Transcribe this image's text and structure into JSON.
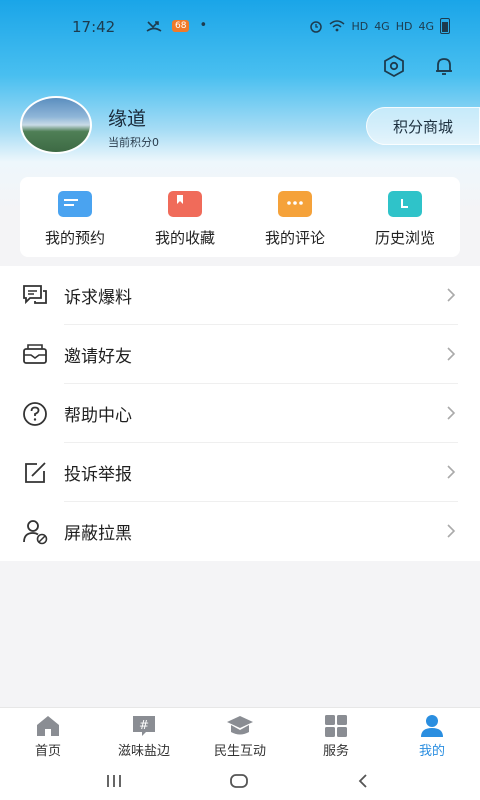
{
  "status_bar": {
    "time": "17:42",
    "network_labels": [
      "HD",
      "4G",
      "HD",
      "4G"
    ],
    "app_badge": "68"
  },
  "header": {
    "settings_icon": "settings-hex-icon",
    "bell_icon": "bell-icon"
  },
  "profile": {
    "name": "缘道",
    "points_label": "当前积分0",
    "mall_button": "积分商城"
  },
  "quick_actions": [
    {
      "label": "我的预约",
      "icon": "reservation-icon",
      "color": "#4aa3f0"
    },
    {
      "label": "我的收藏",
      "icon": "bookmark-icon",
      "color": "#f06b5a"
    },
    {
      "label": "我的评论",
      "icon": "comment-icon",
      "color": "#f5a23a"
    },
    {
      "label": "历史浏览",
      "icon": "history-icon",
      "color": "#2fc3c9"
    }
  ],
  "menu": [
    {
      "label": "诉求爆料",
      "icon": "appeal-icon"
    },
    {
      "label": "邀请好友",
      "icon": "invite-mail-icon"
    },
    {
      "label": "帮助中心",
      "icon": "help-icon"
    },
    {
      "label": "投诉举报",
      "icon": "report-edit-icon"
    },
    {
      "label": "屏蔽拉黑",
      "icon": "block-user-icon"
    }
  ],
  "tabbar": [
    {
      "label": "首页",
      "icon": "home-icon",
      "active": false
    },
    {
      "label": "滋味盐边",
      "icon": "hashtag-icon",
      "active": false
    },
    {
      "label": "民生互动",
      "icon": "graduation-cap-icon",
      "active": false
    },
    {
      "label": "服务",
      "icon": "grid-icon",
      "active": false
    },
    {
      "label": "我的",
      "icon": "user-icon",
      "active": true
    }
  ],
  "colors": {
    "accent": "#2a8ee0",
    "header_top": "#1aa5e8"
  }
}
